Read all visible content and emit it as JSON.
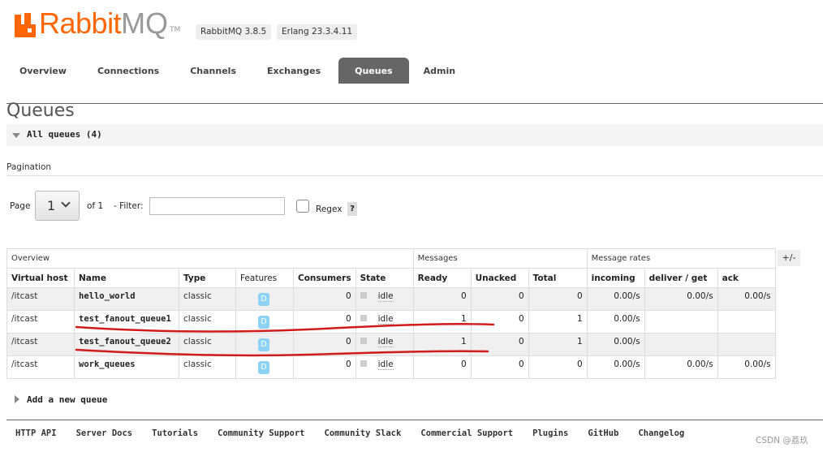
{
  "header": {
    "logo_text_rabbit": "Rabbit",
    "logo_text_mq": "MQ",
    "logo_tm": "TM",
    "rabbitmq_version": "RabbitMQ 3.8.5",
    "erlang_version": "Erlang 23.3.4.11"
  },
  "nav": {
    "tabs": [
      {
        "label": "Overview"
      },
      {
        "label": "Connections"
      },
      {
        "label": "Channels"
      },
      {
        "label": "Exchanges"
      },
      {
        "label": "Queues"
      },
      {
        "label": "Admin"
      }
    ],
    "active": "Queues"
  },
  "page": {
    "title": "Queues",
    "section_label": "All queues (4)",
    "pagination_title": "Pagination"
  },
  "pagination": {
    "page_label": "Page",
    "page_value": "1",
    "of_label": "of 1",
    "filter_label": "- Filter:",
    "filter_value": "",
    "regex_label": "Regex",
    "help": "?"
  },
  "table": {
    "groups": [
      "Overview",
      "Messages",
      "Message rates"
    ],
    "headers": [
      "Virtual host",
      "Name",
      "Type",
      "Features",
      "Consumers",
      "State",
      "Ready",
      "Unacked",
      "Total",
      "incoming",
      "deliver / get",
      "ack"
    ],
    "toggle": "+/-",
    "rows": [
      {
        "vhost": "/itcast",
        "name": "hello_world",
        "type": "classic",
        "features": "D",
        "consumers": "0",
        "state": "idle",
        "ready": "0",
        "unacked": "0",
        "total": "0",
        "incoming": "0.00/s",
        "deliver_get": "0.00/s",
        "ack": "0.00/s"
      },
      {
        "vhost": "/itcast",
        "name": "test_fanout_queue1",
        "type": "classic",
        "features": "D",
        "consumers": "0",
        "state": "idle",
        "ready": "1",
        "unacked": "0",
        "total": "1",
        "incoming": "0.00/s",
        "deliver_get": "",
        "ack": ""
      },
      {
        "vhost": "/itcast",
        "name": "test_fanout_queue2",
        "type": "classic",
        "features": "D",
        "consumers": "0",
        "state": "idle",
        "ready": "1",
        "unacked": "0",
        "total": "1",
        "incoming": "0.00/s",
        "deliver_get": "",
        "ack": ""
      },
      {
        "vhost": "/itcast",
        "name": "work_queues",
        "type": "classic",
        "features": "D",
        "consumers": "0",
        "state": "idle",
        "ready": "0",
        "unacked": "0",
        "total": "0",
        "incoming": "0.00/s",
        "deliver_get": "0.00/s",
        "ack": "0.00/s"
      }
    ]
  },
  "add_queue_label": "Add a new queue",
  "footer": {
    "links": [
      "HTTP API",
      "Server Docs",
      "Tutorials",
      "Community Support",
      "Community Slack",
      "Commercial Support",
      "Plugins",
      "GitHub",
      "Changelog"
    ]
  },
  "watermark": "CSDN @荔玖",
  "colors": {
    "brand_orange": "#ff6600",
    "active_tab": "#666666",
    "feature_badge": "#8cd2f3",
    "annotation_red": "#d11a1a"
  }
}
